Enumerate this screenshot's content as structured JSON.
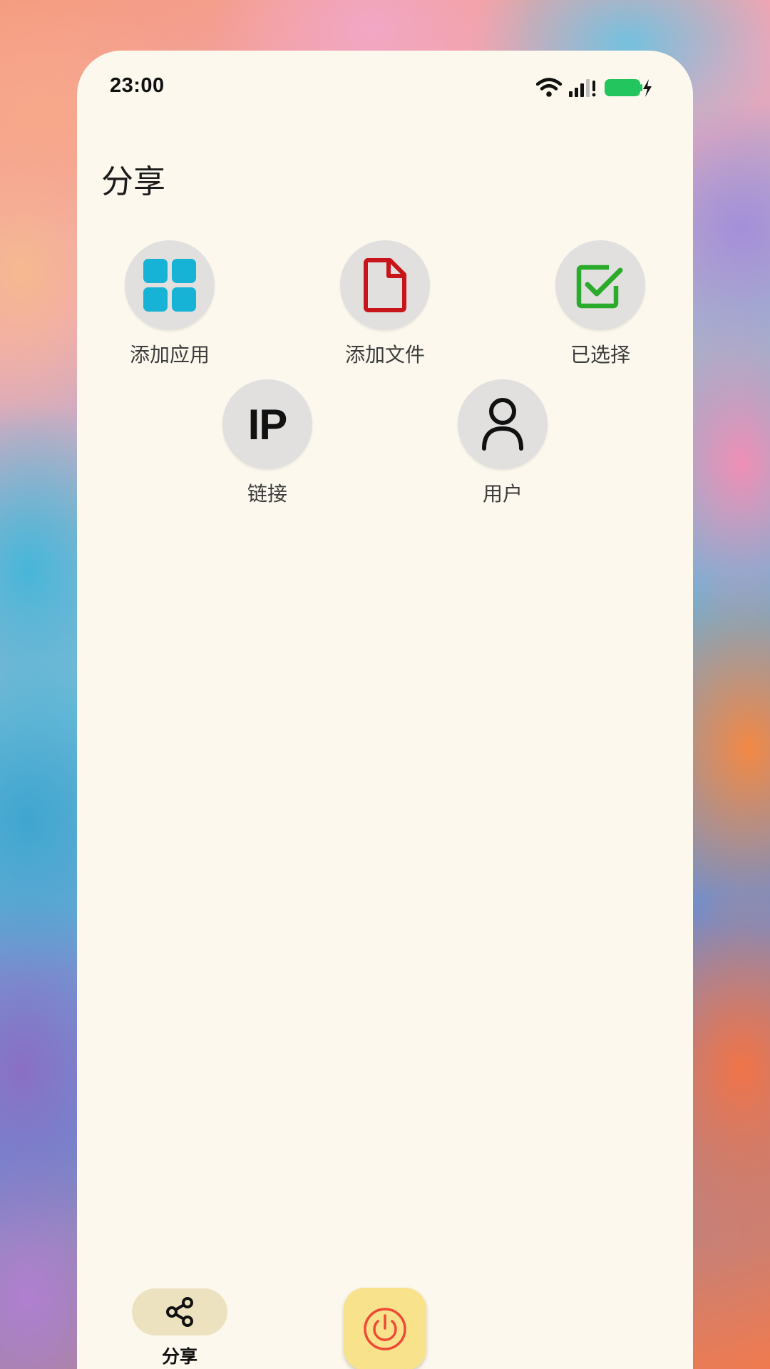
{
  "status_bar": {
    "time": "23:00",
    "icons": [
      "wifi-icon",
      "signal-icon",
      "battery-charging-icon"
    ],
    "battery_color": "#22c55e"
  },
  "page": {
    "title": "分享"
  },
  "actions": [
    {
      "label": "添加应用",
      "icon": "apps-grid-icon",
      "icon_color": "#16b3d6"
    },
    {
      "label": "添加文件",
      "icon": "file-icon",
      "icon_color": "#c8141b"
    },
    {
      "label": "已选择",
      "icon": "checkbox-checked-icon",
      "icon_color": "#2bab2b"
    },
    {
      "label": "链接",
      "icon": "ip-icon",
      "icon_text": "IP"
    },
    {
      "label": "用户",
      "icon": "user-icon"
    }
  ],
  "bottom_nav": {
    "share_label": "分享",
    "share_icon": "share-icon",
    "power_icon": "power-icon",
    "share_pill_color": "#ece2c0",
    "power_button_color": "#f8e38c",
    "power_icon_color": "#ef4a35"
  },
  "colors": {
    "surface": "#fcf8ee",
    "action_circle": "#e1e0df"
  }
}
